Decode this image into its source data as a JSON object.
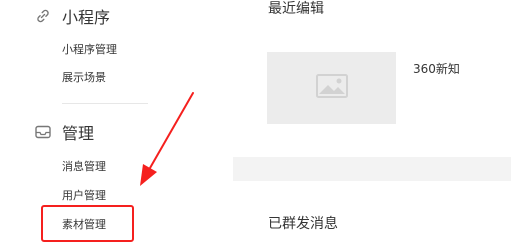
{
  "sidebar": {
    "sections": [
      {
        "title": "小程序",
        "icon": "link-icon",
        "items": [
          {
            "label": "小程序管理"
          },
          {
            "label": "展示场景"
          }
        ]
      },
      {
        "title": "管理",
        "icon": "inbox-icon",
        "items": [
          {
            "label": "消息管理"
          },
          {
            "label": "用户管理"
          },
          {
            "label": "素材管理",
            "highlighted": true
          }
        ]
      }
    ]
  },
  "main": {
    "recent_edit": {
      "title": "最近编辑",
      "item": {
        "title": "360新知",
        "thumbnail_icon": "image-placeholder-icon"
      }
    },
    "mass_sent": {
      "title": "已群发消息"
    }
  },
  "annotation": {
    "arrow_color": "#f5201e",
    "box_color": "#f5201e"
  }
}
